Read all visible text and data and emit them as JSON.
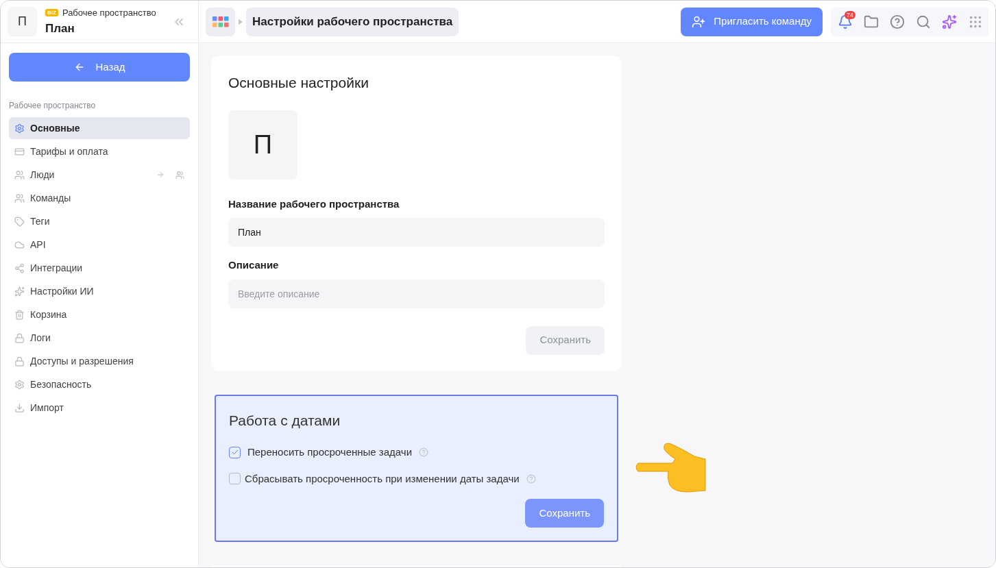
{
  "workspace": {
    "avatar_letter": "П",
    "badge": "BIZ",
    "label": "Рабочее пространство",
    "name": "План"
  },
  "back_button": {
    "label": "Назад"
  },
  "sidebar": {
    "section_title": "Рабочее пространство",
    "items": [
      {
        "label": "Основные",
        "selected": true,
        "kind": "plain"
      },
      {
        "label": "Тарифы и оплата",
        "selected": false,
        "kind": "plain"
      },
      {
        "label": "Люди",
        "selected": false,
        "kind": "linked"
      },
      {
        "label": "Команды",
        "selected": false,
        "kind": "plain"
      },
      {
        "label": "Теги",
        "selected": false,
        "kind": "plain"
      },
      {
        "label": "API",
        "selected": false,
        "kind": "plain"
      },
      {
        "label": "Интеграции",
        "selected": false,
        "kind": "plain"
      },
      {
        "label": "Настройки ИИ",
        "selected": false,
        "kind": "plain"
      },
      {
        "label": "Корзина",
        "selected": false,
        "kind": "plain"
      },
      {
        "label": "Логи",
        "selected": false,
        "kind": "plain"
      },
      {
        "label": "Доступы и разрешения",
        "selected": false,
        "kind": "plain"
      },
      {
        "label": "Безопасность",
        "selected": false,
        "kind": "plain"
      },
      {
        "label": "Импорт",
        "selected": false,
        "kind": "plain"
      }
    ]
  },
  "breadcrumb": {
    "title": "Настройки рабочего пространства"
  },
  "invite_button": {
    "label": "Пригласить команду"
  },
  "notifications": {
    "count": "74"
  },
  "main_settings": {
    "title": "Основные настройки",
    "avatar_letter": "П",
    "name_label": "Название рабочего пространства",
    "name_value": "План",
    "description_label": "Описание",
    "description_placeholder": "Введите описание",
    "save": {
      "label": "Сохранить",
      "disabled": true
    }
  },
  "dates_settings": {
    "title": "Работа с датами",
    "options": [
      {
        "label": "Переносить просроченные задачи",
        "checked": true
      },
      {
        "label": "Сбрасывать просроченность при изменении даты задачи",
        "checked": false
      }
    ],
    "save": {
      "label": "Сохранить",
      "disabled": false
    }
  }
}
